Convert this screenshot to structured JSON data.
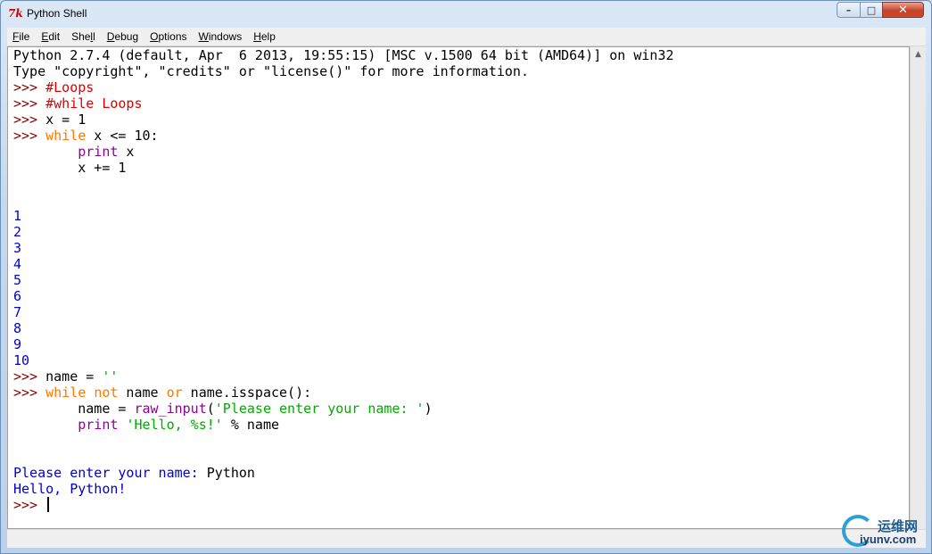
{
  "window": {
    "title": "Python Shell",
    "controls": {
      "minimize": "–",
      "maximize": "□",
      "close": "✕"
    }
  },
  "menu": [
    {
      "u": "F",
      "rest": "ile"
    },
    {
      "u": "E",
      "rest": "dit"
    },
    {
      "pre": "She",
      "u": "l",
      "rest": "l"
    },
    {
      "u": "D",
      "rest": "ebug"
    },
    {
      "u": "O",
      "rest": "ptions"
    },
    {
      "u": "W",
      "rest": "indows"
    },
    {
      "u": "H",
      "rest": "elp"
    }
  ],
  "shell": {
    "lines": [
      [
        {
          "t": "Python 2.7.4 (default, Apr  6 2013, 19:55:15) [MSC v.1500 64 bit (AMD64)] on win32",
          "c": ""
        }
      ],
      [
        {
          "t": "Type \"copyright\", \"credits\" or \"license()\" for more information.",
          "c": ""
        }
      ],
      [
        {
          "t": ">>> ",
          "c": "prompt"
        },
        {
          "t": "#Loops",
          "c": "comment"
        }
      ],
      [
        {
          "t": ">>> ",
          "c": "prompt"
        },
        {
          "t": "#while Loops",
          "c": "comment"
        }
      ],
      [
        {
          "t": ">>> ",
          "c": "prompt"
        },
        {
          "t": "x = 1",
          "c": ""
        }
      ],
      [
        {
          "t": ">>> ",
          "c": "prompt"
        },
        {
          "t": "while",
          "c": "kw"
        },
        {
          "t": " x <= 10:",
          "c": ""
        }
      ],
      [
        {
          "t": "        ",
          "c": ""
        },
        {
          "t": "print",
          "c": "builtin"
        },
        {
          "t": " x",
          "c": ""
        }
      ],
      [
        {
          "t": "        x += 1",
          "c": ""
        }
      ],
      [],
      [],
      [
        {
          "t": "1",
          "c": "out"
        }
      ],
      [
        {
          "t": "2",
          "c": "out"
        }
      ],
      [
        {
          "t": "3",
          "c": "out"
        }
      ],
      [
        {
          "t": "4",
          "c": "out"
        }
      ],
      [
        {
          "t": "5",
          "c": "out"
        }
      ],
      [
        {
          "t": "6",
          "c": "out"
        }
      ],
      [
        {
          "t": "7",
          "c": "out"
        }
      ],
      [
        {
          "t": "8",
          "c": "out"
        }
      ],
      [
        {
          "t": "9",
          "c": "out"
        }
      ],
      [
        {
          "t": "10",
          "c": "out"
        }
      ],
      [
        {
          "t": ">>> ",
          "c": "prompt"
        },
        {
          "t": "name = ",
          "c": ""
        },
        {
          "t": "''",
          "c": "str"
        }
      ],
      [
        {
          "t": ">>> ",
          "c": "prompt"
        },
        {
          "t": "while",
          "c": "kw"
        },
        {
          "t": " ",
          "c": ""
        },
        {
          "t": "not",
          "c": "kw"
        },
        {
          "t": " name ",
          "c": ""
        },
        {
          "t": "or",
          "c": "kw"
        },
        {
          "t": " name.isspace():",
          "c": ""
        }
      ],
      [
        {
          "t": "        name = ",
          "c": ""
        },
        {
          "t": "raw_input",
          "c": "builtin"
        },
        {
          "t": "(",
          "c": ""
        },
        {
          "t": "'Please enter your name: '",
          "c": "str"
        },
        {
          "t": ")",
          "c": ""
        }
      ],
      [
        {
          "t": "        ",
          "c": ""
        },
        {
          "t": "print",
          "c": "builtin"
        },
        {
          "t": " ",
          "c": ""
        },
        {
          "t": "'Hello, %s!'",
          "c": "str"
        },
        {
          "t": " % name",
          "c": ""
        }
      ],
      [],
      [],
      [
        {
          "t": "Please enter your name: ",
          "c": "out"
        },
        {
          "t": "Python",
          "c": ""
        }
      ],
      [
        {
          "t": "Hello, Python!",
          "c": "out"
        }
      ],
      [
        {
          "t": ">>> ",
          "c": "prompt"
        }
      ]
    ]
  },
  "watermark": {
    "cn": "运维网",
    "url": "iyunv.com"
  },
  "colors": {
    "prompt": "#8b0000",
    "comment": "#dd0000",
    "keyword": "#ff7700",
    "builtin": "#900090",
    "string": "#00aa00",
    "output": "#0000cc"
  }
}
